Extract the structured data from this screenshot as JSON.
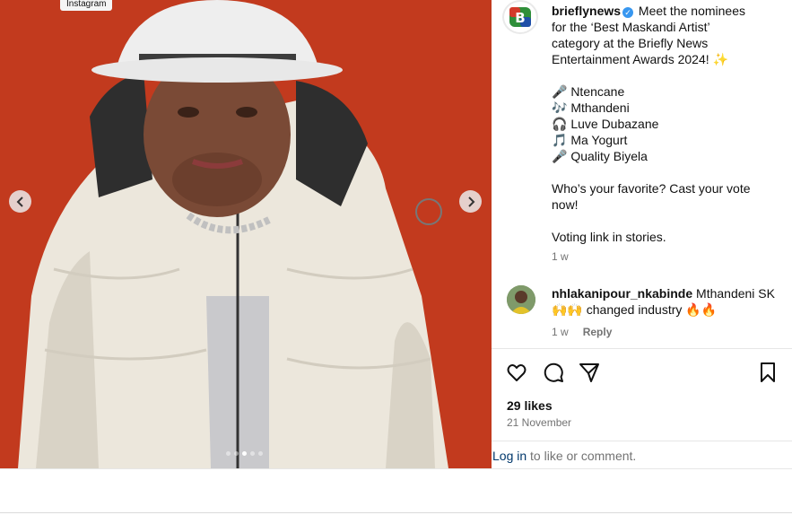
{
  "media": {
    "source_tag": "Instagram",
    "prev_icon": "chevron-left-icon",
    "next_icon": "chevron-right-icon",
    "slide_count": 5,
    "active_slide": 3,
    "background_color": "#c23a1e"
  },
  "post": {
    "username": "brieflynews",
    "verified": true,
    "caption_lines": [
      "Meet the nominees",
      "for the ‘Best Maskandi Artist’",
      "category at the Briefly News",
      "Entertainment Awards 2024! ✨",
      "",
      "🎤 Ntencane",
      "🎶 Mthandeni",
      "🎧 Luve Dubazane",
      "🎵 Ma Yogurt",
      "🎤 Quality Biyela",
      "",
      "Who’s your favorite? Cast your vote",
      "now!",
      "",
      "Voting link in stories."
    ],
    "age": "1 w"
  },
  "comment": {
    "username": "nhlakanipour_nkabinde",
    "text": "Mthandeni SK 🙌🙌 changed industry 🔥🔥",
    "age": "1 w",
    "reply_label": "Reply"
  },
  "actions": {
    "like_icon": "heart-icon",
    "comment_icon": "comment-icon",
    "share_icon": "send-icon",
    "save_icon": "bookmark-icon"
  },
  "stats": {
    "likes": "29 likes",
    "date": "21 November"
  },
  "login_prompt": {
    "link": "Log in",
    "rest": " to like or comment."
  },
  "colors": {
    "accent_link": "#00376b",
    "verified_blue": "#3897f0",
    "muted_text": "#737373"
  }
}
